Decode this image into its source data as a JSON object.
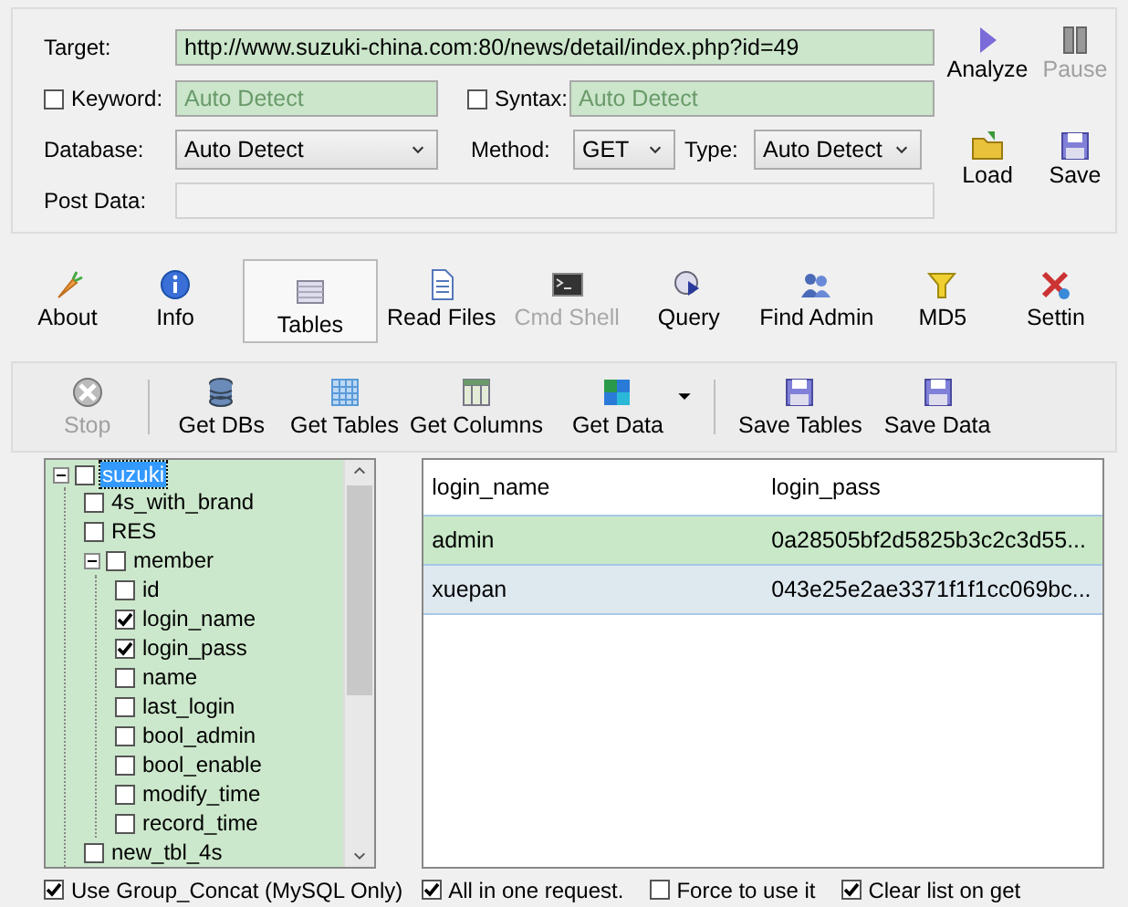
{
  "form": {
    "target_label": "Target:",
    "target": "http://www.suzuki-china.com:80/news/detail/index.php?id=49",
    "keyword": {
      "label": "Keyword:",
      "checked": false,
      "placeholder": "Auto Detect"
    },
    "syntax": {
      "label": "Syntax:",
      "checked": false,
      "placeholder": "Auto Detect"
    },
    "database": {
      "label": "Database:",
      "value": "Auto Detect"
    },
    "method": {
      "label": "Method:",
      "value": "GET"
    },
    "type": {
      "label": "Type:",
      "value": "Auto Detect"
    },
    "post_data_label": "Post Data:",
    "actions": [
      {
        "label": "Analyze",
        "disabled": false
      },
      {
        "label": "Pause",
        "disabled": true
      },
      {
        "label": "Load",
        "disabled": false
      },
      {
        "label": "Save",
        "disabled": false
      }
    ]
  },
  "tabs": [
    {
      "label": "About",
      "selected": false,
      "disabled": false
    },
    {
      "label": "Info",
      "selected": false,
      "disabled": false
    },
    {
      "label": "Tables",
      "selected": true,
      "disabled": false
    },
    {
      "label": "Read Files",
      "selected": false,
      "disabled": false
    },
    {
      "label": "Cmd Shell",
      "selected": false,
      "disabled": true
    },
    {
      "label": "Query",
      "selected": false,
      "disabled": false
    },
    {
      "label": "Find Admin",
      "selected": false,
      "disabled": false
    },
    {
      "label": "MD5",
      "selected": false,
      "disabled": false
    },
    {
      "label": "Settin",
      "selected": false,
      "disabled": false
    }
  ],
  "toolbar": [
    [
      {
        "label": "Stop",
        "disabled": true,
        "menu": false
      }
    ],
    [
      {
        "label": "Get DBs",
        "disabled": false,
        "menu": false
      },
      {
        "label": "Get Tables",
        "disabled": false,
        "menu": false
      },
      {
        "label": "Get Columns",
        "disabled": false,
        "menu": false
      },
      {
        "label": "Get Data",
        "disabled": false,
        "menu": true
      }
    ],
    [
      {
        "label": "Save Tables",
        "disabled": false,
        "menu": false
      },
      {
        "label": "Save Data",
        "disabled": false,
        "menu": false
      }
    ]
  ],
  "tree": {
    "items": [
      {
        "label": "suzuki",
        "checked": false,
        "selected": true,
        "expanded": true,
        "children": [
          {
            "label": "4s_with_brand",
            "checked": false,
            "selected": false
          },
          {
            "label": "RES",
            "checked": false,
            "selected": false
          },
          {
            "label": "member",
            "checked": false,
            "selected": false,
            "expanded": true,
            "children": [
              {
                "label": "id",
                "checked": false,
                "selected": false
              },
              {
                "label": "login_name",
                "checked": true,
                "selected": false
              },
              {
                "label": "login_pass",
                "checked": true,
                "selected": false
              },
              {
                "label": "name",
                "checked": false,
                "selected": false
              },
              {
                "label": "last_login",
                "checked": false,
                "selected": false
              },
              {
                "label": "bool_admin",
                "checked": false,
                "selected": false
              },
              {
                "label": "bool_enable",
                "checked": false,
                "selected": false
              },
              {
                "label": "modify_time",
                "checked": false,
                "selected": false
              },
              {
                "label": "record_time",
                "checked": false,
                "selected": false
              }
            ]
          },
          {
            "label": "new_tbl_4s",
            "checked": false,
            "selected": false
          }
        ]
      }
    ],
    "options": [
      {
        "label": "Use Group_Concat (MySQL Only)",
        "checked": true
      }
    ]
  },
  "table": {
    "columns": [
      "login_name",
      "login_pass"
    ],
    "rows": [
      {
        "cells": [
          "admin",
          "0a28505bf2d5825b3c2c3d55..."
        ],
        "selected": true
      },
      {
        "cells": [
          "xuepan",
          "043e25e2ae3371f1f1cc069bc..."
        ],
        "selected": false
      }
    ],
    "options": [
      {
        "label": "All in one request.",
        "checked": true
      },
      {
        "label": "Force to use it",
        "checked": false
      },
      {
        "label": "Clear list on get",
        "checked": true
      }
    ]
  }
}
